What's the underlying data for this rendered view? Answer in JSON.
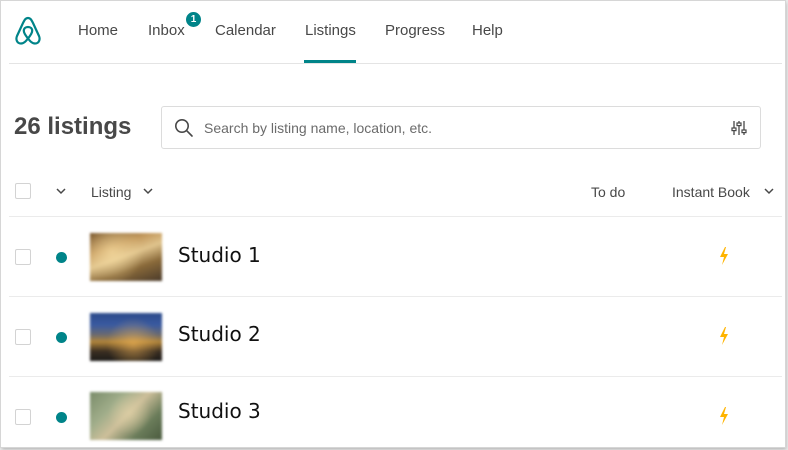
{
  "nav": {
    "items": [
      {
        "label": "Home"
      },
      {
        "label": "Inbox",
        "badge": "1"
      },
      {
        "label": "Calendar"
      },
      {
        "label": "Listings",
        "active": true
      },
      {
        "label": "Progress"
      },
      {
        "label": "Help"
      }
    ]
  },
  "page": {
    "title": "26 listings"
  },
  "search": {
    "placeholder": "Search by listing name, location, etc.",
    "value": ""
  },
  "table": {
    "columns": {
      "listing": "Listing",
      "todo": "To do",
      "instant_book": "Instant Book"
    },
    "rows": [
      {
        "name": "Studio 1",
        "status": "listed",
        "instant_book": true
      },
      {
        "name": "Studio 2",
        "status": "listed",
        "instant_book": true
      },
      {
        "name": "Studio 3",
        "status": "listed",
        "instant_book": true
      }
    ]
  },
  "icons": {
    "logo": "airbnb-logo-icon",
    "search": "search-icon",
    "filter": "filter-sliders-icon",
    "instant_book": "lightning-bolt-icon"
  },
  "colors": {
    "accent": "#008489",
    "bolt": "#ffb400",
    "text": "#484848"
  }
}
